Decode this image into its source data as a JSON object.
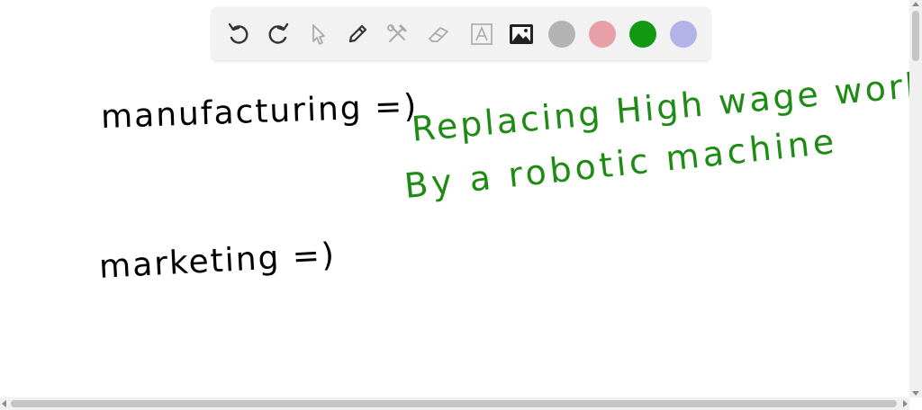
{
  "toolbar": {
    "tools": [
      {
        "icon": "undo-icon"
      },
      {
        "icon": "redo-icon"
      },
      {
        "icon": "select-pointer-icon"
      },
      {
        "icon": "pen-icon"
      },
      {
        "icon": "tools-icon"
      },
      {
        "icon": "eraser-icon"
      },
      {
        "icon": "text-icon"
      },
      {
        "icon": "image-icon"
      }
    ],
    "colors": [
      "#b3b3b3",
      "#e8a0a8",
      "#119911",
      "#b3b3e8"
    ],
    "selected_color": "#119911"
  },
  "canvas": {
    "ink_black": "#000000",
    "ink_green": "#1e8c14",
    "strokes": [
      {
        "text": "manufacturing =)",
        "color": "black"
      },
      {
        "text": "Replacing High wage workers",
        "color": "green"
      },
      {
        "text": "By a robotic machine",
        "color": "green"
      },
      {
        "text": "marketing =)",
        "color": "black"
      }
    ]
  }
}
